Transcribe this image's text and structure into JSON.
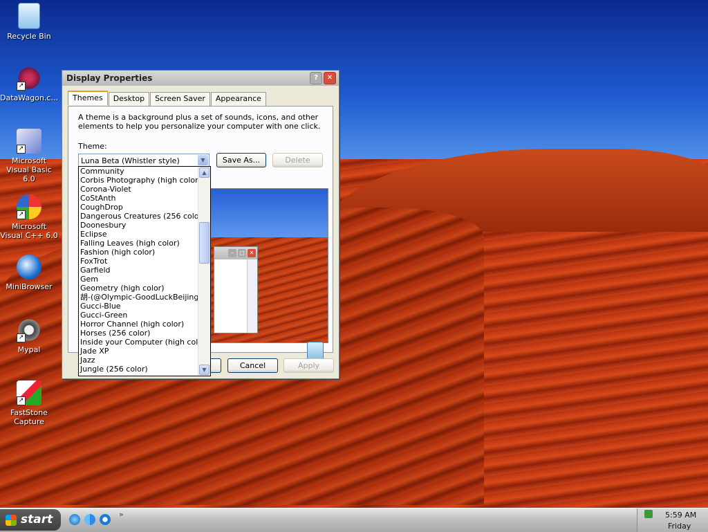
{
  "desktop": {
    "icons": [
      {
        "label": "Recycle Bin",
        "icon": "recycle-bin-icon"
      },
      {
        "label": "DataWagon.c...",
        "icon": "datawagon-icon"
      },
      {
        "label": "Microsoft Visual Basic 6.0",
        "icon": "visual-basic-icon"
      },
      {
        "label": "Microsoft Visual C++ 6.0",
        "icon": "visual-cpp-icon"
      },
      {
        "label": "MiniBrowser",
        "icon": "minibrowser-icon"
      },
      {
        "label": "Mypal",
        "icon": "mypal-icon"
      },
      {
        "label": "FastStone Capture",
        "icon": "faststone-icon"
      }
    ]
  },
  "dialog": {
    "title": "Display Properties",
    "help_glyph": "?",
    "close_glyph": "✕",
    "tabs": [
      "Themes",
      "Desktop",
      "Screen Saver",
      "Appearance"
    ],
    "description": "A theme is a background plus a set of sounds, icons, and other elements to help you personalize your computer with one click.",
    "theme_label": "Theme:",
    "selected_theme": "Luna Beta (Whistler style) (Modified)",
    "save_as": "Save As...",
    "delete": "Delete",
    "ok": "OK",
    "cancel": "Cancel",
    "apply": "Apply",
    "theme_options": [
      "Community",
      "Corbis Photography (high color)",
      "Corona-Violet",
      "CoStAnth",
      "CoughDrop",
      "Dangerous Creatures (256 color)",
      "Doonesbury",
      "Eclipse",
      "Falling Leaves (high color)",
      "Fashion (high color)",
      "FoxTrot",
      "Garfield",
      "Gem",
      "Geometry (high color)",
      "胡-(@Olympic-GoodLuckBeijing",
      "Gucci-Blue",
      "Gucci-Green",
      "Horror Channel (high color)",
      "Horses (256 color)",
      "Inside your Computer (high color)",
      "Jade XP",
      "Jazz",
      "Jungle (256 color)"
    ]
  },
  "taskbar": {
    "start_label": "start",
    "chevron": "»",
    "time": "5:59 AM",
    "day": "Friday"
  }
}
